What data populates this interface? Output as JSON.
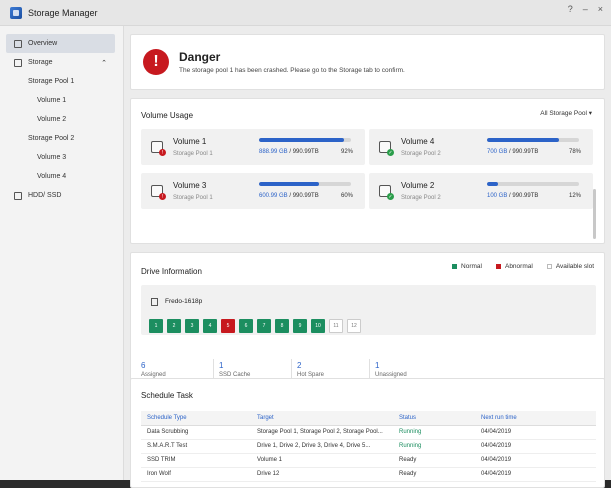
{
  "window": {
    "title": "Storage Manager"
  },
  "sidebar": {
    "items": [
      {
        "label": "Overview"
      },
      {
        "label": "Storage"
      },
      {
        "label": "Storage Pool 1"
      },
      {
        "label": "Volume 1"
      },
      {
        "label": "Volume 2"
      },
      {
        "label": "Storage Pool 2"
      },
      {
        "label": "Volume 3"
      },
      {
        "label": "Volume 4"
      },
      {
        "label": "HDD/ SSD"
      }
    ]
  },
  "alert": {
    "title": "Danger",
    "message": "The storage pool 1 has been crashed. Please go to the Storage tab to confirm."
  },
  "volume_usage": {
    "title": "Volume Usage",
    "filter": "All Storage Pool",
    "volumes": [
      {
        "name": "Volume 1",
        "pool": "Storage Pool 1",
        "used": "888.99 GB",
        "total": " / 990.99TB",
        "percent_label": "92%",
        "fill": 0.92,
        "status": "bad"
      },
      {
        "name": "Volume 4",
        "pool": "Storage Pool 2",
        "used": "700 GB",
        "total": " / 990.99TB",
        "percent_label": "78%",
        "fill": 0.78,
        "status": "good"
      },
      {
        "name": "Volume 3",
        "pool": "Storage Pool 1",
        "used": "600.99 GB",
        "total": " / 990.99TB",
        "percent_label": "60%",
        "fill": 0.65,
        "status": "bad"
      },
      {
        "name": "Volume 2",
        "pool": "Storage Pool 2",
        "used": "100 GB",
        "total": " / 990.99TB",
        "percent_label": "12%",
        "fill": 0.12,
        "status": "good"
      }
    ]
  },
  "drive_info": {
    "title": "Drive Information",
    "legend": {
      "normal": "Normal",
      "abnormal": "Abnormal",
      "available": "Available slot"
    },
    "nas_name": "Fredo-1618p",
    "slots": [
      {
        "n": "1",
        "state": "normal"
      },
      {
        "n": "2",
        "state": "normal"
      },
      {
        "n": "3",
        "state": "normal"
      },
      {
        "n": "4",
        "state": "normal"
      },
      {
        "n": "5",
        "state": "abnormal"
      },
      {
        "n": "6",
        "state": "normal"
      },
      {
        "n": "7",
        "state": "normal"
      },
      {
        "n": "8",
        "state": "normal"
      },
      {
        "n": "9",
        "state": "normal"
      },
      {
        "n": "10",
        "state": "normal"
      },
      {
        "n": "11",
        "state": "empty"
      },
      {
        "n": "12",
        "state": "empty"
      }
    ],
    "stats": [
      {
        "value": "6",
        "label": "Assigned"
      },
      {
        "value": "1",
        "label": "SSD Cache"
      },
      {
        "value": "2",
        "label": "Hot Spare"
      },
      {
        "value": "1",
        "label": "Unassigned"
      }
    ]
  },
  "schedule": {
    "title": "Schedule Task",
    "headers": [
      "Schedule Type",
      "Target",
      "Status",
      "Next run time"
    ],
    "rows": [
      [
        "Data Scrubbing",
        "Storage Pool 1, Storage Pool 2, Storage Pool...",
        "Running",
        "04/04/2019"
      ],
      [
        "S.M.A.R.T Test",
        "Drive 1, Drive 2, Drive 3, Drive 4, Drive 5...",
        "Running",
        "04/04/2019"
      ],
      [
        "SSD TRIM",
        "Volume 1",
        "Ready",
        "04/04/2019"
      ],
      [
        "Iron Wolf",
        "Drive 12",
        "Ready",
        "04/04/2019"
      ]
    ]
  },
  "colors": {
    "accent": "#2c63c8",
    "danger": "#c7191f",
    "normal": "#1c8e60"
  }
}
